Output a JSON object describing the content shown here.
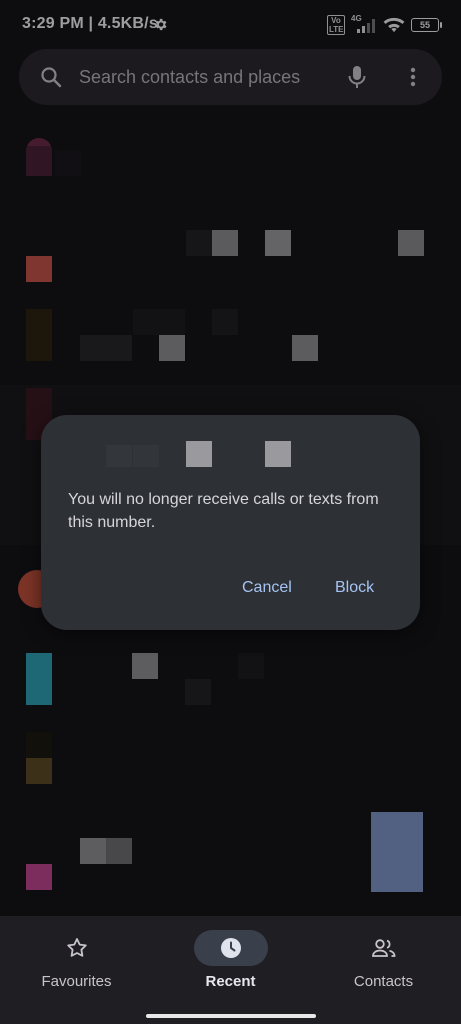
{
  "status_bar": {
    "time": "3:29 PM | 4.5KB/s",
    "network_type": "4G",
    "volte_label": "Vo LTE",
    "battery": "55"
  },
  "search": {
    "placeholder": "Search contacts and places"
  },
  "dialog": {
    "message": "You will no longer receive calls or texts from this number.",
    "cancel_label": "Cancel",
    "block_label": "Block"
  },
  "bottom_nav": {
    "items": [
      {
        "label": "Favourites",
        "icon": "star-icon",
        "active": false
      },
      {
        "label": "Recent",
        "icon": "clock-icon",
        "active": true
      },
      {
        "label": "Contacts",
        "icon": "people-icon",
        "active": false
      }
    ]
  },
  "colors": {
    "background": "#141317",
    "dialog_bg": "#2d3035",
    "accent": "#a6c4f2",
    "nav_active_pill": "#3a3f4c"
  }
}
